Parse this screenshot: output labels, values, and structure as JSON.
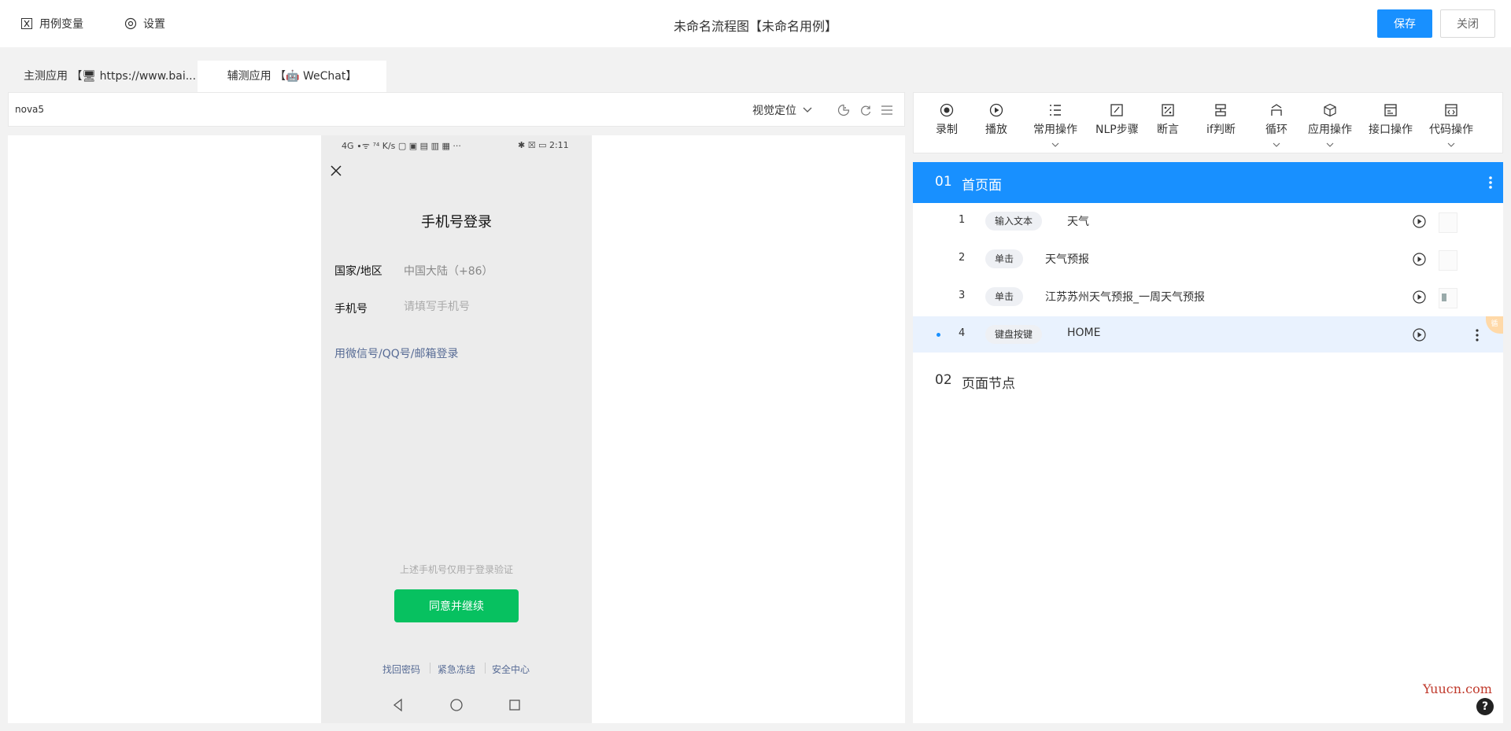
{
  "header": {
    "variables_label": "用例变量",
    "settings_label": "设置",
    "title": "未命名流程图【未命名用例】",
    "save_label": "保存",
    "close_label": "关闭"
  },
  "tabs": [
    {
      "label": "主测应用 【🖥 https://www.bai..."
    },
    {
      "label": "辅测应用 【🤖 WeChat】"
    }
  ],
  "device_bar": {
    "device": "nova5",
    "locate_mode": "视觉定位"
  },
  "phone": {
    "status_left": "4G ∙ᯤ ⁷⁴ K/s ▢ ▣ ▤ ▥ ▦ ···",
    "status_right": "✱ ☒ ▭ 2:11",
    "title": "手机号登录",
    "region_label": "国家/地区",
    "region_value": "中国大陆（+86）",
    "phone_label": "手机号",
    "phone_placeholder": "请填写手机号",
    "alt_login": "用微信号/QQ号/邮箱登录",
    "note": "上述手机号仅用于登录验证",
    "agree_button": "同意并继续",
    "footer_links": [
      "找回密码",
      "紧急冻结",
      "安全中心"
    ]
  },
  "toolbar": {
    "items": [
      {
        "label": "录制",
        "icon": "record-icon"
      },
      {
        "label": "播放",
        "icon": "play-icon"
      },
      {
        "label": "常用操作",
        "icon": "list-icon"
      },
      {
        "label": "NLP步骤",
        "icon": "nlp-icon"
      },
      {
        "label": "断言",
        "icon": "assert-icon"
      },
      {
        "label": "if判断",
        "icon": "if-icon"
      },
      {
        "label": "循环",
        "icon": "loop-icon"
      },
      {
        "label": "应用操作",
        "icon": "cube-icon"
      },
      {
        "label": "接口操作",
        "icon": "api-icon"
      },
      {
        "label": "代码操作",
        "icon": "code-icon"
      }
    ]
  },
  "steps": {
    "section1": {
      "num": "01",
      "title": "首页面"
    },
    "rows": [
      {
        "num": "1",
        "action": "输入文本",
        "target": "天气"
      },
      {
        "num": "2",
        "action": "单击",
        "target": "天气预报"
      },
      {
        "num": "3",
        "action": "单击",
        "target": "江苏苏州天气预报_一周天气预报"
      },
      {
        "num": "4",
        "action": "键盘按键",
        "target": "HOME"
      }
    ],
    "row4_badge": "循",
    "section2": {
      "num": "02",
      "title": "页面节点"
    }
  },
  "watermark": "Yuucn.com",
  "help": "?",
  "colors": {
    "primary": "#1890ff",
    "wechat_green": "#07c160",
    "link": "#576b95"
  }
}
